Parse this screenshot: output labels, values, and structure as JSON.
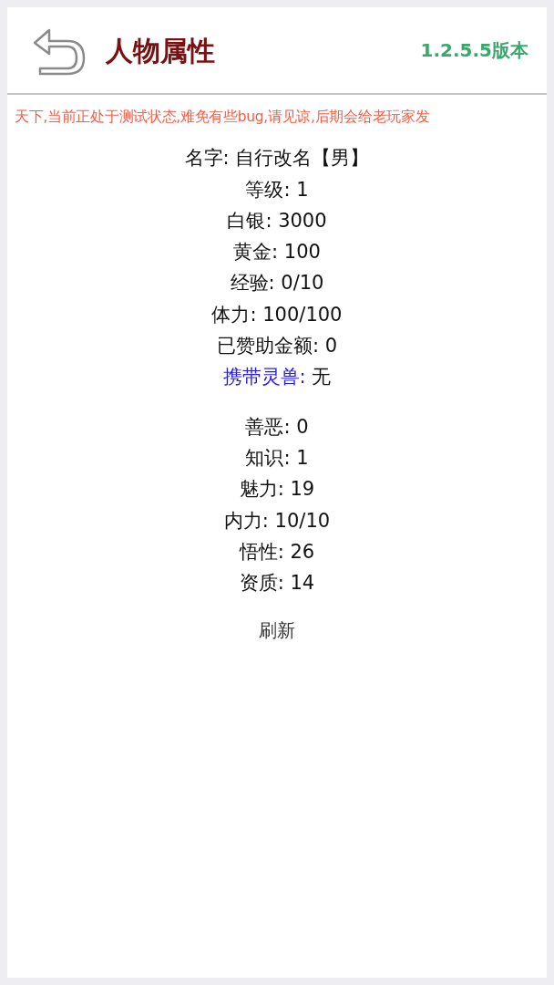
{
  "header": {
    "title": "人物属性",
    "version": "1.2.5.5版本"
  },
  "notice": "天下,当前正处于测试状态,难免有些bug,请见谅,后期会给老玩家发",
  "stat_groups": [
    [
      {
        "label": "名字:",
        "value": "自行改名【男】",
        "highlight": false
      },
      {
        "label": "等级:",
        "value": "1",
        "highlight": false
      },
      {
        "label": "白银:",
        "value": "3000",
        "highlight": false
      },
      {
        "label": "黄金:",
        "value": "100",
        "highlight": false
      },
      {
        "label": "经验:",
        "value": "0/10",
        "highlight": false
      },
      {
        "label": "体力:",
        "value": "100/100",
        "highlight": false
      },
      {
        "label": "已赞助金额:",
        "value": "0",
        "highlight": false
      },
      {
        "label": "携带灵兽:",
        "value": "无",
        "highlight": true
      }
    ],
    [
      {
        "label": "善恶:",
        "value": "0",
        "highlight": false
      },
      {
        "label": "知识:",
        "value": "1",
        "highlight": false
      },
      {
        "label": "魅力:",
        "value": "19",
        "highlight": false
      },
      {
        "label": "内力:",
        "value": "10/10",
        "highlight": false
      },
      {
        "label": "悟性:",
        "value": "26",
        "highlight": false
      },
      {
        "label": "资质:",
        "value": "14",
        "highlight": false
      }
    ]
  ],
  "refresh": "刷新"
}
